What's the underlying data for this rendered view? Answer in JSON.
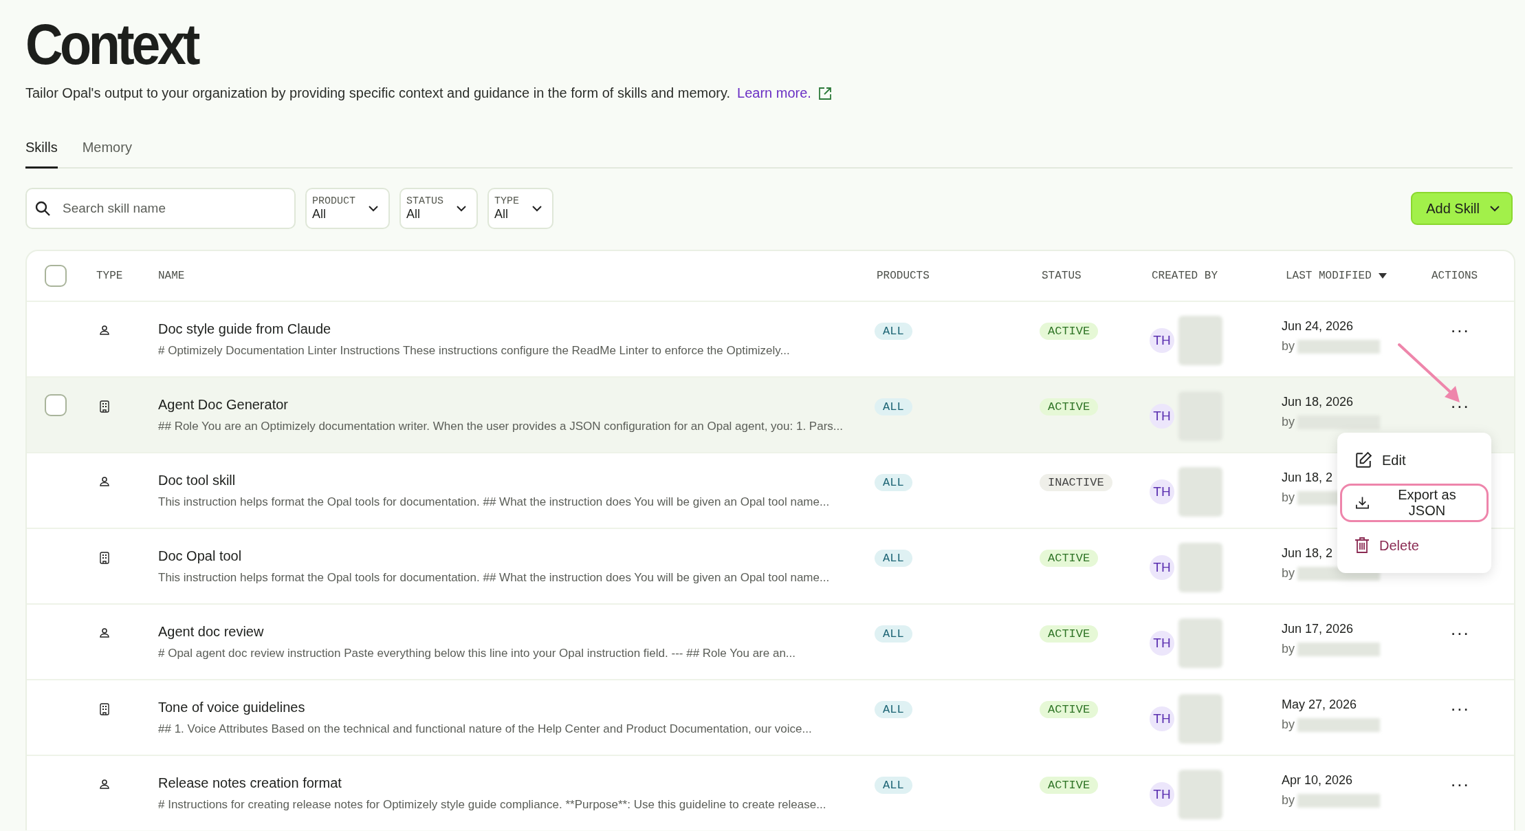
{
  "page": {
    "title": "Context",
    "description": "Tailor Opal's output to your organization by providing specific context and guidance in the form of skills and memory.",
    "learn_more": "Learn more."
  },
  "tabs": [
    {
      "label": "Skills",
      "selected": true
    },
    {
      "label": "Memory",
      "selected": false
    }
  ],
  "search": {
    "placeholder": "Search skill name"
  },
  "filters": [
    {
      "label": "PRODUCT",
      "value": "All"
    },
    {
      "label": "STATUS",
      "value": "All"
    },
    {
      "label": "TYPE",
      "value": "All"
    }
  ],
  "add_button": {
    "label": "Add Skill"
  },
  "table": {
    "select_all": {
      "checked": false
    },
    "columns": [
      {
        "label": "TYPE",
        "sorted": false
      },
      {
        "label": "NAME",
        "sorted": false
      },
      {
        "label": "PRODUCTS",
        "sorted": false
      },
      {
        "label": "STATUS",
        "sorted": false
      },
      {
        "label": "CREATED BY",
        "sorted": false
      },
      {
        "label": "LAST MODIFIED",
        "sorted": true
      },
      {
        "label": "ACTIONS",
        "sorted": false
      }
    ],
    "rows": [
      {
        "kind": "person",
        "name": "Doc style guide from Claude",
        "description": "# Optimizely Documentation Linter Instructions These instructions configure the ReadMe Linter to enforce the Optimizely...",
        "product": "ALL",
        "status": "ACTIVE",
        "active": true,
        "initials": "TH",
        "modified": "Jun 24, 2026",
        "by": "by",
        "hovered": false,
        "checked": false,
        "actions": "..."
      },
      {
        "kind": "building",
        "name": "Agent Doc Generator",
        "description": "## Role You are an Optimizely documentation writer. When the user provides a JSON configuration for an Opal agent, you: 1. Pars...",
        "product": "ALL",
        "status": "ACTIVE",
        "active": true,
        "initials": "TH",
        "modified": "Jun 18, 2026",
        "by": "by",
        "hovered": true,
        "checked": false,
        "actions": "..."
      },
      {
        "kind": "person",
        "name": "Doc tool skill",
        "description": "This instruction helps format the Opal tools for documentation. ## What the instruction does You will be given an Opal tool name...",
        "product": "ALL",
        "status": "INACTIVE",
        "active": false,
        "initials": "TH",
        "modified": "Jun 18, 2",
        "by": "by",
        "hovered": false,
        "checked": false
      },
      {
        "kind": "building",
        "name": "Doc Opal tool",
        "description": "This instruction helps format the Opal tools for documentation. ## What the instruction does You will be given an Opal tool name...",
        "product": "ALL",
        "status": "ACTIVE",
        "active": true,
        "initials": "TH",
        "modified": "Jun 18, 2",
        "by": "by",
        "hovered": false,
        "checked": false
      },
      {
        "kind": "person",
        "name": "Agent doc review",
        "description": "# Opal agent doc review instruction Paste everything below this line into your Opal instruction field. --- ## Role You are an...",
        "product": "ALL",
        "status": "ACTIVE",
        "active": true,
        "initials": "TH",
        "modified": "Jun 17, 2026",
        "by": "by",
        "hovered": false,
        "checked": false,
        "actions": "..."
      },
      {
        "kind": "building",
        "name": "Tone of voice guidelines",
        "description": "## 1. Voice Attributes Based on the technical and functional nature of the Help Center and Product Documentation, our voice...",
        "product": "ALL",
        "status": "ACTIVE",
        "active": true,
        "initials": "TH",
        "modified": "May 27, 2026",
        "by": "by",
        "hovered": false,
        "checked": false,
        "actions": "..."
      },
      {
        "kind": "person",
        "name": "Release notes creation format",
        "description": "# Instructions for creating release notes for Optimizely style guide compliance. **Purpose**: Use this guideline to create release...",
        "product": "ALL",
        "status": "ACTIVE",
        "active": true,
        "initials": "TH",
        "modified": "Apr 10, 2026",
        "by": "by",
        "hovered": false,
        "checked": false,
        "actions": "..."
      }
    ]
  },
  "menu": {
    "items": [
      {
        "kind": "edit",
        "label": "Edit",
        "highlighted": false
      },
      {
        "kind": "export",
        "label": "Export as JSON",
        "highlighted": true
      },
      {
        "kind": "delete",
        "label": "Delete",
        "highlighted": false
      }
    ]
  }
}
